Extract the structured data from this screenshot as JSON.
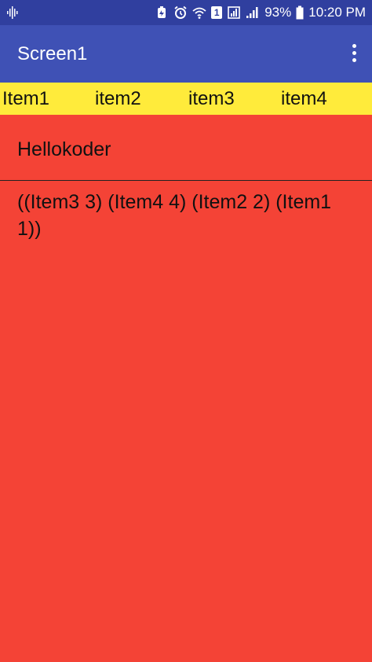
{
  "status_bar": {
    "battery_percent": "93%",
    "time": "10:20 PM",
    "sim_label": "1"
  },
  "app_bar": {
    "title": "Screen1"
  },
  "tabs": [
    {
      "label": "Item1"
    },
    {
      "label": "item2"
    },
    {
      "label": "item3"
    },
    {
      "label": "item4"
    }
  ],
  "content": {
    "line1": "Hellokoder",
    "line2": "((Item3 3) (Item4 4) (Item2 2) (Item1 1))"
  },
  "colors": {
    "status_bar": "#303F9F",
    "app_bar": "#3F51B5",
    "tab_bar": "#FFEB3B",
    "background": "#F44336"
  }
}
